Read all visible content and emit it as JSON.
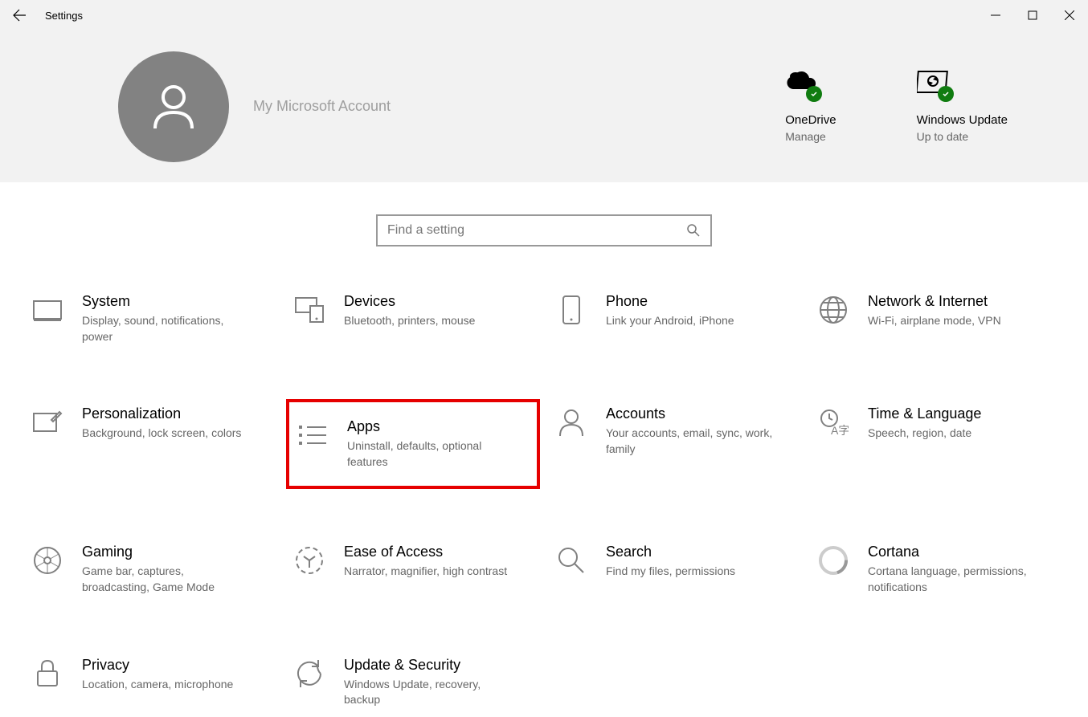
{
  "window": {
    "title": "Settings"
  },
  "header": {
    "account_label": "My Microsoft Account",
    "status": [
      {
        "title": "OneDrive",
        "subtitle": "Manage"
      },
      {
        "title": "Windows Update",
        "subtitle": "Up to date"
      }
    ]
  },
  "search": {
    "placeholder": "Find a setting"
  },
  "categories": [
    {
      "id": "system",
      "title": "System",
      "desc": "Display, sound, notifications, power",
      "highlight": false
    },
    {
      "id": "devices",
      "title": "Devices",
      "desc": "Bluetooth, printers, mouse",
      "highlight": false
    },
    {
      "id": "phone",
      "title": "Phone",
      "desc": "Link your Android, iPhone",
      "highlight": false
    },
    {
      "id": "network",
      "title": "Network & Internet",
      "desc": "Wi-Fi, airplane mode, VPN",
      "highlight": false
    },
    {
      "id": "personalization",
      "title": "Personalization",
      "desc": "Background, lock screen, colors",
      "highlight": false
    },
    {
      "id": "apps",
      "title": "Apps",
      "desc": "Uninstall, defaults, optional features",
      "highlight": true
    },
    {
      "id": "accounts",
      "title": "Accounts",
      "desc": "Your accounts, email, sync, work, family",
      "highlight": false
    },
    {
      "id": "time",
      "title": "Time & Language",
      "desc": "Speech, region, date",
      "highlight": false
    },
    {
      "id": "gaming",
      "title": "Gaming",
      "desc": "Game bar, captures, broadcasting, Game Mode",
      "highlight": false
    },
    {
      "id": "ease",
      "title": "Ease of Access",
      "desc": "Narrator, magnifier, high contrast",
      "highlight": false
    },
    {
      "id": "search",
      "title": "Search",
      "desc": "Find my files, permissions",
      "highlight": false
    },
    {
      "id": "cortana",
      "title": "Cortana",
      "desc": "Cortana language, permissions, notifications",
      "highlight": false
    },
    {
      "id": "privacy",
      "title": "Privacy",
      "desc": "Location, camera, microphone",
      "highlight": false
    },
    {
      "id": "update",
      "title": "Update & Security",
      "desc": "Windows Update, recovery, backup",
      "highlight": false
    }
  ]
}
